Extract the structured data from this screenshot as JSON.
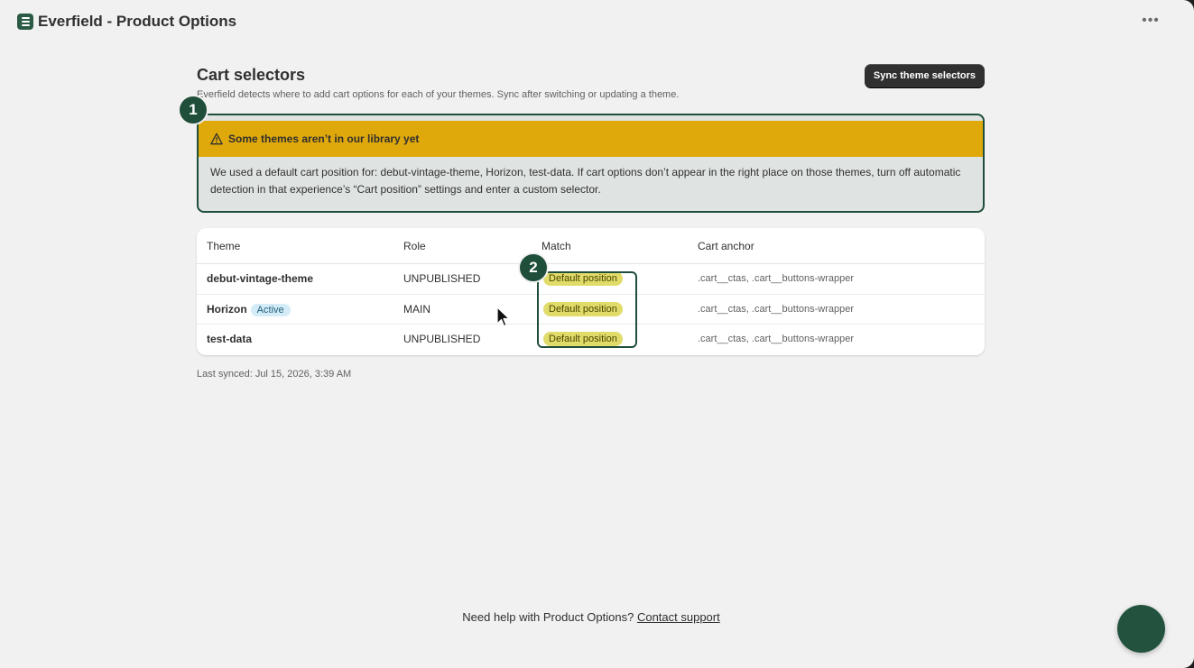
{
  "app": {
    "title": "Everfield - Product Options",
    "menu_icon": "more-horizontal-icon"
  },
  "page": {
    "title": "Cart selectors",
    "subtitle": "Everfield detects where to add cart options for each of your themes. Sync after switching or updating a theme.",
    "sync_button": "Sync theme selectors"
  },
  "banner": {
    "title": "Some themes aren’t in our library yet",
    "body": "We used a default cart position for: debut-vintage-theme, Horizon, test-data. If cart options don’t appear in the right place on those themes, turn off automatic detection in that experience’s “Cart position” settings and enter a custom selector.",
    "tone_color": "#dfa80b"
  },
  "markers": [
    "1",
    "2"
  ],
  "table": {
    "headers": {
      "theme": "Theme",
      "role": "Role",
      "match": "Match",
      "anchor": "Cart anchor"
    },
    "rows": [
      {
        "theme": "debut-vintage-theme",
        "badge": "",
        "role": "UNPUBLISHED",
        "match": "Default position",
        "anchor": ".cart__ctas, .cart__buttons-wrapper"
      },
      {
        "theme": "Horizon",
        "badge": "Active",
        "role": "MAIN",
        "match": "Default position",
        "anchor": ".cart__ctas, .cart__buttons-wrapper"
      },
      {
        "theme": "test-data",
        "badge": "",
        "role": "UNPUBLISHED",
        "match": "Default position",
        "anchor": ".cart__ctas, .cart__buttons-wrapper"
      }
    ]
  },
  "last_synced": "Last synced: Jul 15, 2026, 3:39 AM",
  "footer": {
    "help_text": "Need help with Product Options?",
    "link": "Contact support"
  }
}
